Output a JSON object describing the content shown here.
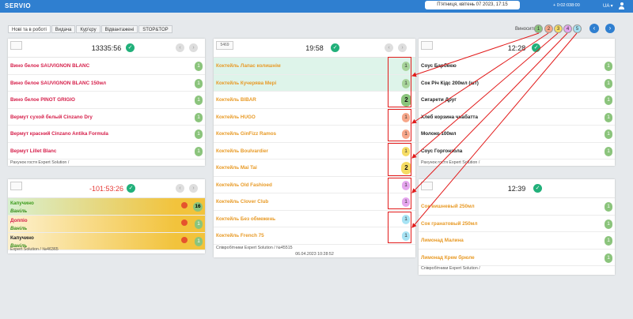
{
  "header": {
    "brand": "SERVIO",
    "date": "П'ятниця, квітень 07 2023, 17:15",
    "clock": "+ 0:02:038:00",
    "lang": "UA ▾"
  },
  "tabs": [
    {
      "label": "Нові та в роботі"
    },
    {
      "label": "Видача"
    },
    {
      "label": "Кур'єру"
    },
    {
      "label": "Відвантажені"
    },
    {
      "label": "STOP&TOP"
    }
  ],
  "filters": {
    "label": "Виносити",
    "dots": [
      {
        "label": "1",
        "color": "#8bc47c"
      },
      {
        "label": "2",
        "color": "#f7a78a"
      },
      {
        "label": "3",
        "color": "#f5dc64"
      },
      {
        "label": "4",
        "color": "#e5a6ee"
      },
      {
        "label": "5",
        "color": "#a7e3f4"
      }
    ],
    "prev": "‹",
    "next": "›"
  },
  "panels": {
    "p1": {
      "title": "13335:56",
      "items": [
        {
          "name": "Вино белое SAUVIGNON BLANC",
          "qty": "1"
        },
        {
          "name": "Вино белое SAUVIGNON BLANC 150мл",
          "qty": "1"
        },
        {
          "name": "Вино белое PINOT GRIGIO",
          "qty": "1"
        },
        {
          "name": "Вермут сухой белый Cinzano Dry",
          "qty": "1"
        },
        {
          "name": "Вермут красний Cinzano Antika Formula",
          "qty": "1"
        },
        {
          "name": "Вермут Lillet Blanc",
          "qty": "1"
        }
      ],
      "footer": "Рахунок гостя Expert Solution /"
    },
    "p2": {
      "badge": "5469",
      "title": "19:58",
      "items": [
        {
          "name": "Коктейль Лапас колишнім",
          "qty": "1"
        },
        {
          "name": "Коктейль Кучерява Мері",
          "qty": "1"
        },
        {
          "name": "Коктейль BIBAR",
          "qty": "2"
        },
        {
          "name": "Коктейль HUGO",
          "qty": "1"
        },
        {
          "name": "Коктейль GinFizz Ramos",
          "qty": "1"
        },
        {
          "name": "Коктейль Boulvardier",
          "qty": "1"
        },
        {
          "name": "Коктейль Mai Tai",
          "qty": "2"
        },
        {
          "name": "Коктейль Old Fashioed",
          "qty": "1"
        },
        {
          "name": "Коктейль Clover Club",
          "qty": "1"
        },
        {
          "name": "Коктейль Без обмежень",
          "qty": "1"
        },
        {
          "name": "Коктейль French 75",
          "qty": "1"
        }
      ],
      "footer": "Співробітники Expert Solution / №45515",
      "date": "06.04.2023 10:28:52"
    },
    "p3": {
      "title": "12:28",
      "items": [
        {
          "name": "Соус Барбекю",
          "qty": "1"
        },
        {
          "name": "Сок Річ Кідс 200мл (шт)",
          "qty": "1"
        },
        {
          "name": "Сигарети Друг",
          "qty": "1"
        },
        {
          "name": "Хлеб корзина чиабатта",
          "qty": "1"
        },
        {
          "name": "Молоко 100мл",
          "qty": "1"
        },
        {
          "name": "Соус Горгонзола",
          "qty": "1"
        }
      ],
      "footer": "Рахунок гостя Expert Solution /"
    },
    "p4": {
      "title": "-101:53:26",
      "items": [
        {
          "name": "Капучино",
          "sub": "Ваніль",
          "qty": "16"
        },
        {
          "name": "Доппіо",
          "sub": "Ваніль",
          "qty": "1"
        },
        {
          "name": "Капучино",
          "sub": "Ваніль",
          "qty": "1"
        }
      ],
      "footer": "Expert Solution / №46365"
    },
    "p5": {
      "title": "12:39",
      "items": [
        {
          "name": "Сок вишневый 250мл",
          "qty": "1"
        },
        {
          "name": "Сок гранатовый 250мл",
          "qty": "1"
        },
        {
          "name": "Лимонад Малина",
          "qty": "1"
        },
        {
          "name": "Лимонад Крем брюле",
          "qty": "1"
        }
      ],
      "footer": "Співробітники Expert Solution /"
    }
  },
  "colors": {
    "header": "#2f7fd0",
    "check": "#21b07a",
    "highlight": "#e21b1b"
  }
}
